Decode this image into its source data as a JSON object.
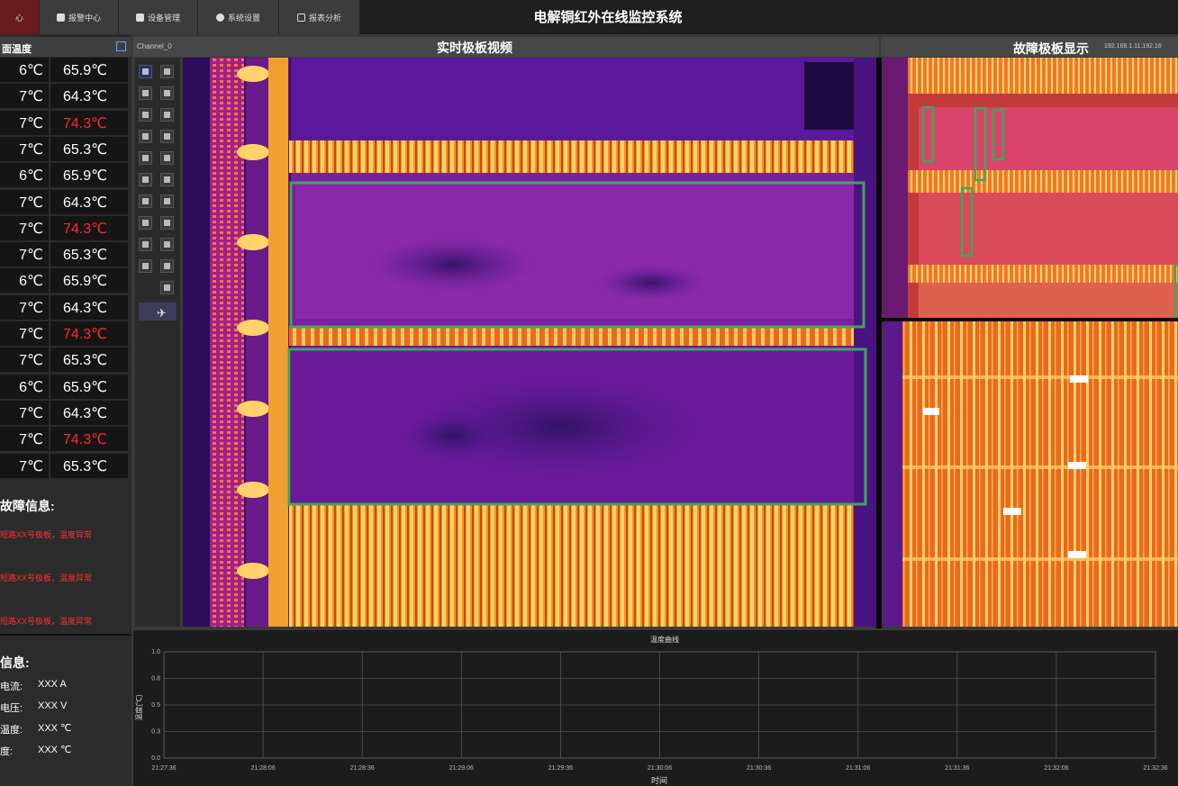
{
  "app_title": "电解铜红外在线监控系统",
  "tabs": [
    {
      "label": "心",
      "active": true
    },
    {
      "label": "报警中心",
      "active": false
    },
    {
      "label": "设备管理",
      "active": false
    },
    {
      "label": "系统设置",
      "active": false
    },
    {
      "label": "报表分析",
      "active": false
    }
  ],
  "left": {
    "header": "面温度",
    "temp_rows": [
      {
        "a": "6℃",
        "b": "65.9℃",
        "hot": false
      },
      {
        "a": "7℃",
        "b": "64.3℃",
        "hot": false
      },
      {
        "a": "7℃",
        "b": "74.3℃",
        "hot": true
      },
      {
        "a": "7℃",
        "b": "65.3℃",
        "hot": false
      },
      {
        "a": "6℃",
        "b": "65.9℃",
        "hot": false
      },
      {
        "a": "7℃",
        "b": "64.3℃",
        "hot": false
      },
      {
        "a": "7℃",
        "b": "74.3℃",
        "hot": true
      },
      {
        "a": "7℃",
        "b": "65.3℃",
        "hot": false
      },
      {
        "a": "6℃",
        "b": "65.9℃",
        "hot": false
      },
      {
        "a": "7℃",
        "b": "64.3℃",
        "hot": false
      },
      {
        "a": "7℃",
        "b": "74.3℃",
        "hot": true
      },
      {
        "a": "7℃",
        "b": "65.3℃",
        "hot": false
      },
      {
        "a": "6℃",
        "b": "65.9℃",
        "hot": false
      },
      {
        "a": "7℃",
        "b": "64.3℃",
        "hot": false
      },
      {
        "a": "7℃",
        "b": "74.3℃",
        "hot": true
      },
      {
        "a": "7℃",
        "b": "65.3℃",
        "hot": false
      }
    ],
    "fault_title": "故障信息:",
    "fault_lines": [
      "短路XX号极板，温度异常",
      "短路XX号极板，温度异常",
      "短路XX号极板，温度异常"
    ],
    "info_title": "信息:",
    "info": [
      {
        "label": "电流:",
        "value": "XXX A"
      },
      {
        "label": "电压:",
        "value": "XXX V"
      },
      {
        "label": "温度:",
        "value": "XXX ℃"
      },
      {
        "label": "度:",
        "value": "XXX ℃"
      }
    ]
  },
  "center": {
    "channel": "Channel_0",
    "title": "实时极板视频"
  },
  "right": {
    "title": "故障极板显示",
    "ip": "192.168.1.11:192.16"
  },
  "chart_data": {
    "type": "line",
    "title": "温度曲线",
    "xlabel": "时间",
    "ylabel": "温度(℃)",
    "ylim": [
      0,
      1.0
    ],
    "y_ticks": [
      "1.0",
      "0.8",
      "0.5",
      "0.3",
      "0.0"
    ],
    "x_ticks": [
      "21:27:36",
      "21:28:06",
      "21:28:36",
      "21:29:06",
      "21:29:36",
      "21:30:06",
      "21:30:36",
      "21:31:06",
      "21:31:36",
      "21:32:06",
      "21:32:36"
    ],
    "series": [],
    "grid": true
  },
  "colors": {
    "accent": "#6a1b1b",
    "hot_text": "#ff2a2a",
    "roi_box": "#3fa65a"
  }
}
